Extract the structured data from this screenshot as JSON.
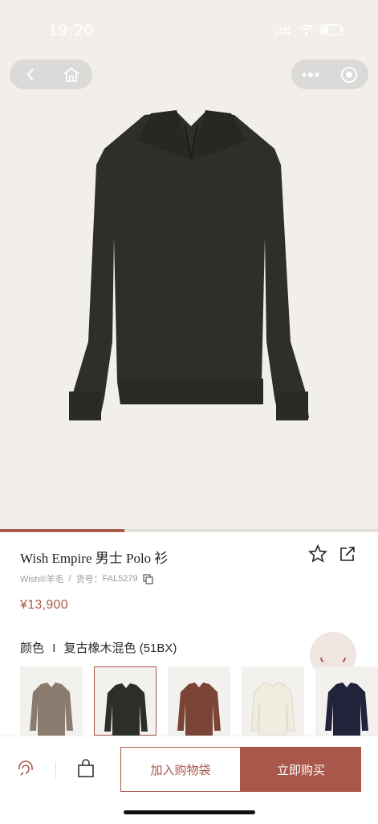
{
  "status_bar": {
    "time": "19:20"
  },
  "product": {
    "title": "Wish Empire 男士 Polo 衫",
    "material": "Wish®羊毛",
    "separator": "/",
    "sku_label": "货号：",
    "sku": "FAL5279",
    "price": "¥13,900",
    "color_label": "颜色",
    "color_divider": "I",
    "color_value": "复古橡木混色 (51BX)"
  },
  "gallery": {
    "progress": 0.33
  },
  "swatches": [
    {
      "color": "#8b7b6e",
      "selected": false
    },
    {
      "color": "#2b2e29",
      "selected": true
    },
    {
      "color": "#7a4437",
      "selected": false
    },
    {
      "color": "#f1ece0",
      "selected": false
    },
    {
      "color": "#20233a",
      "selected": false
    }
  ],
  "actions": {
    "add_to_bag": "加入购物袋",
    "buy_now": "立即购买"
  },
  "icons": {
    "back": "chevron-left-icon",
    "home": "home-icon",
    "more": "more-dots-icon",
    "close": "mini-program-close-icon",
    "favorite": "star-icon",
    "share": "share-icon",
    "copy": "copy-icon",
    "service": "customer-service-icon",
    "bag": "shopping-bag-icon"
  },
  "colors": {
    "accent": "#a9574a",
    "hero_bg": "#f2efeb"
  }
}
